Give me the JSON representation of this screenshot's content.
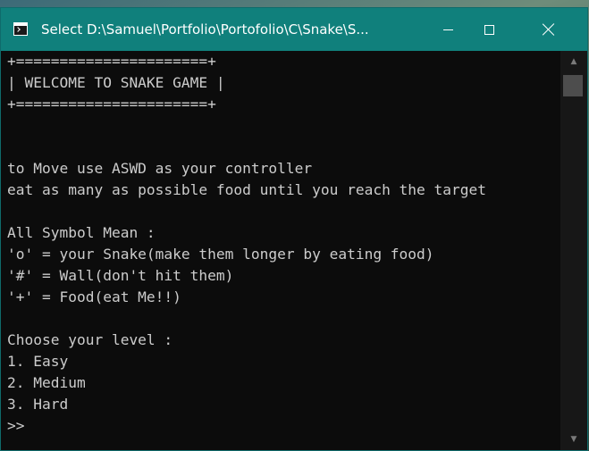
{
  "window": {
    "title": "Select D:\\Samuel\\Portfolio\\Portofolio\\C\\Snake\\S..."
  },
  "controls": {
    "minimize_icon": "minimize-icon",
    "maximize_icon": "maximize-icon",
    "close_icon": "close-icon"
  },
  "console": {
    "lines": [
      "+======================+",
      "| WELCOME TO SNAKE GAME |",
      "+======================+",
      "",
      "",
      "to Move use ASWD as your controller",
      "eat as many as possible food until you reach the target",
      "",
      "All Symbol Mean :",
      "'o' = your Snake(make them longer by eating food)",
      "'#' = Wall(don't hit them)",
      "'+' = Food(eat Me!!)",
      "",
      "Choose your level :",
      "1. Easy",
      "2. Medium",
      "3. Hard",
      ">>"
    ]
  },
  "scrollbar": {
    "up_arrow": "▲",
    "down_arrow": "▼"
  },
  "colors": {
    "titlebar": "#10807c",
    "console_bg": "#0c0c0c",
    "console_text": "#cccccc"
  }
}
